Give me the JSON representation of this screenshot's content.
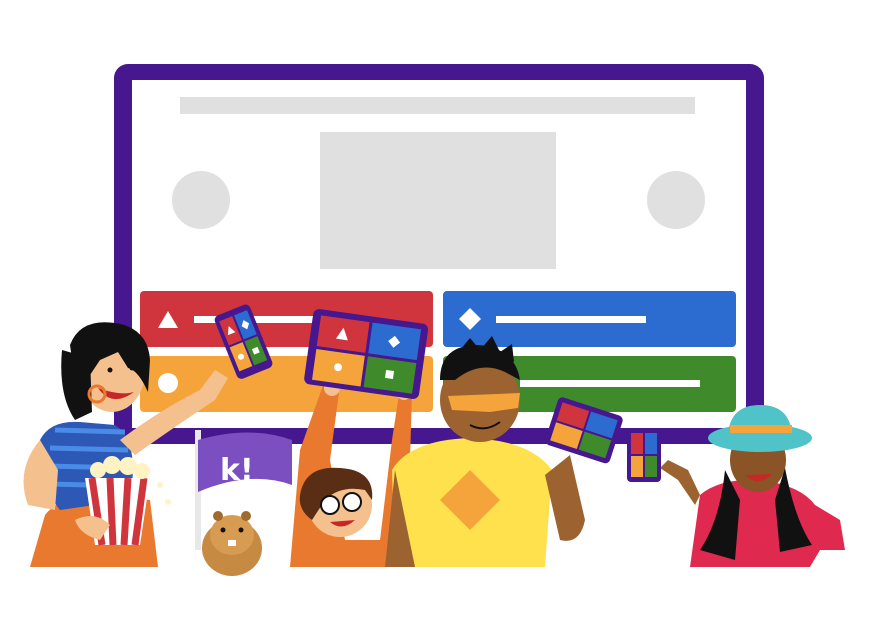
{
  "scene": {
    "description_free": true,
    "colors": {
      "screen_frame": "#46178F",
      "placeholder_gray": "#E0E0E0",
      "answer_red": "#D0353E",
      "answer_blue": "#2C6BD0",
      "answer_orange": "#F4A43A",
      "answer_green": "#3F8B2C",
      "flag_purple": "#7B4FBF"
    },
    "answer_icons": [
      "triangle-icon",
      "diamond-icon",
      "circle-icon",
      "square-icon"
    ],
    "flag": {
      "text": "k!"
    }
  }
}
